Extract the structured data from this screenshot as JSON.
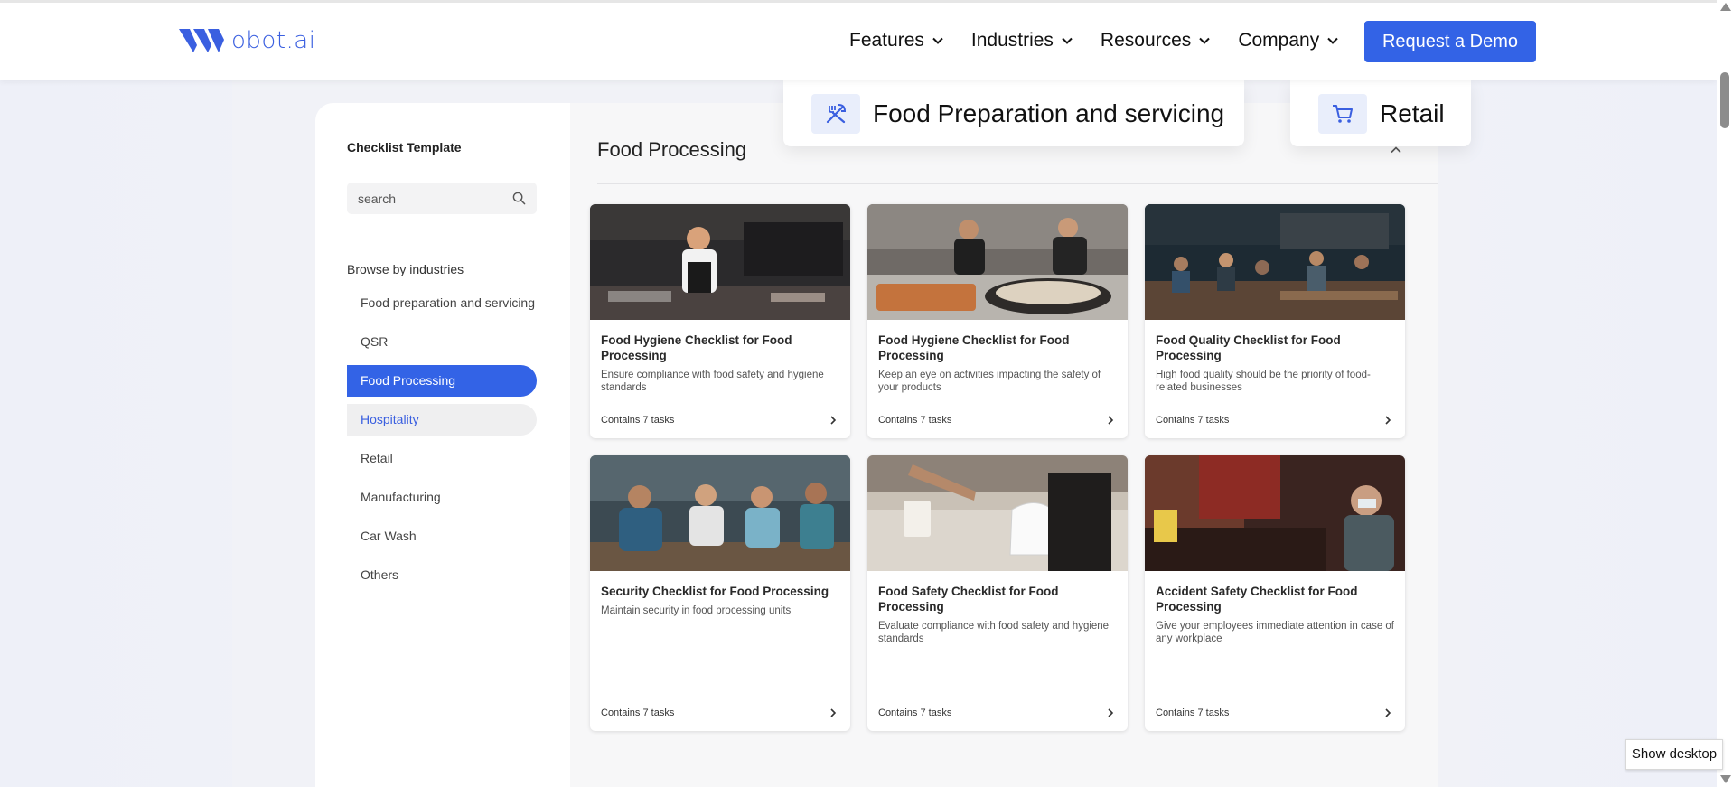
{
  "header": {
    "logo_text": "obot.ai",
    "nav": [
      {
        "label": "Features"
      },
      {
        "label": "Industries"
      },
      {
        "label": "Resources"
      },
      {
        "label": "Company"
      }
    ],
    "demo_label": "Request a Demo",
    "accent": "#3363e6"
  },
  "dropdown": {
    "items": [
      {
        "label": "Food Preparation and servicing",
        "icon": "fork-knife-icon"
      },
      {
        "label": "Retail",
        "icon": "cart-icon"
      }
    ]
  },
  "sidebar": {
    "title": "Checklist Template",
    "search_placeholder": "search",
    "browse_label": "Browse by industries",
    "industries": [
      {
        "label": "Food preparation and servicing",
        "state": ""
      },
      {
        "label": "QSR",
        "state": ""
      },
      {
        "label": "Food Processing",
        "state": "active"
      },
      {
        "label": "Hospitality",
        "state": "hover"
      },
      {
        "label": "Retail",
        "state": ""
      },
      {
        "label": "Manufacturing",
        "state": ""
      },
      {
        "label": "Car Wash",
        "state": ""
      },
      {
        "label": "Others",
        "state": ""
      }
    ]
  },
  "main": {
    "title": "Food Processing",
    "cards": [
      {
        "title": "Food Hygiene Checklist for Food Processing",
        "desc": "Ensure compliance with food safety and hygiene standards",
        "tasks": "Contains 7 tasks"
      },
      {
        "title": "Food Hygiene Checklist for Food Processing",
        "desc": "Keep an eye on activities impacting the safety of your products",
        "tasks": "Contains 7 tasks"
      },
      {
        "title": "Food Quality Checklist for Food Processing",
        "desc": "High food quality should be the priority of food-related businesses",
        "tasks": "Contains 7 tasks"
      },
      {
        "title": "Security Checklist for Food Processing",
        "desc": "Maintain security in food processing units",
        "tasks": "Contains 7 tasks"
      },
      {
        "title": "Food Safety Checklist for Food Processing",
        "desc": "Evaluate compliance with food safety and hygiene standards",
        "tasks": "Contains 7 tasks"
      },
      {
        "title": "Accident Safety Checklist for Food Processing",
        "desc": "Give your employees immediate attention in case of any workplace",
        "tasks": "Contains 7 tasks"
      }
    ]
  },
  "tooltip": {
    "label": "Show desktop"
  }
}
